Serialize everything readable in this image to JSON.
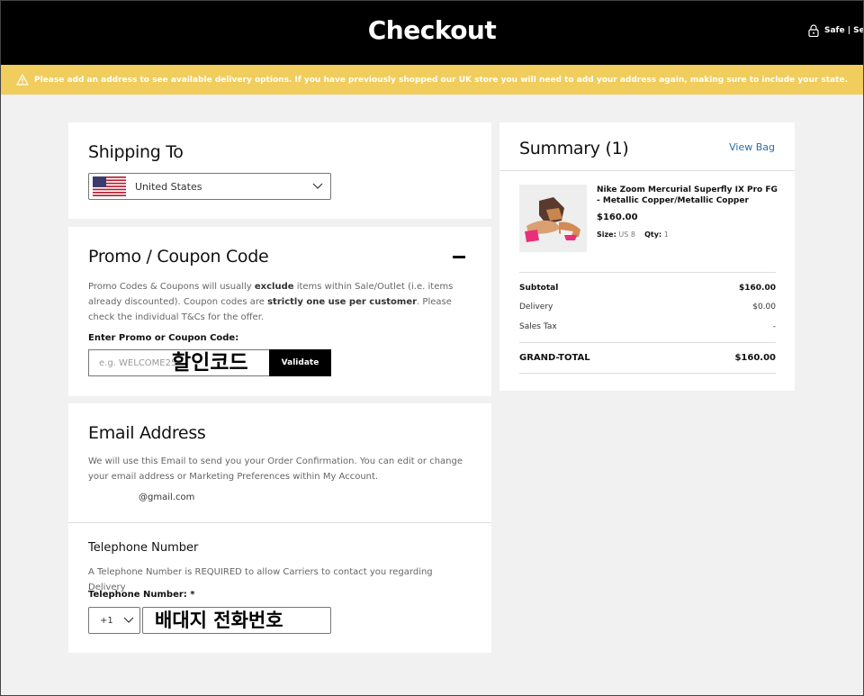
{
  "header": {
    "title": "Checkout",
    "secure_text": "Safe | Se"
  },
  "banner": {
    "text": "Please add an address to see available delivery options. If you have previously shopped our UK store you will need to add your address again, making sure to include your state."
  },
  "shipping": {
    "title": "Shipping To",
    "country": "United States"
  },
  "promo": {
    "title": "Promo / Coupon Code",
    "desc_1": "Promo Codes & Coupons will usually ",
    "desc_exclude": "exclude",
    "desc_2": " items within Sale/Outlet (i.e. items already discounted). Coupon codes are ",
    "desc_strict": "strictly one use per customer",
    "desc_3": ". Please check the individual T&Cs for the offer.",
    "label": "Enter Promo or Coupon Code:",
    "placeholder": "e.g. WELCOME25",
    "overlay": "할인코드",
    "button": "Validate"
  },
  "email": {
    "title": "Email Address",
    "desc": "We will use this Email to send you your Order Confirmation. You can edit or change your email address or Marketing Preferences within My Account.",
    "value": "@gmail.com"
  },
  "phone": {
    "title": "Telephone Number",
    "desc": "A Telephone Number is REQUIRED to allow Carriers to contact you regarding Delivery",
    "label": "Telephone Number: *",
    "prefix": "+1",
    "overlay": "배대지 전화번호"
  },
  "summary": {
    "title": "Summary (1)",
    "view_bag": "View Bag",
    "product": {
      "name": "Nike Zoom Mercurial Superfly IX Pro FG - Metallic Copper/Metallic Copper",
      "price": "$160.00",
      "size_label": "Size:",
      "size": "US 8",
      "qty_label": "Qty:",
      "qty": "1"
    },
    "subtotal_label": "Subtotal",
    "subtotal": "$160.00",
    "delivery_label": "Delivery",
    "delivery": "$0.00",
    "tax_label": "Sales Tax",
    "tax": "-",
    "grand_label": "GRAND-TOTAL",
    "grand": "$160.00"
  },
  "colors": {
    "header": "#000000",
    "banner": "#f0cd5c",
    "link": "#2a6da8"
  }
}
